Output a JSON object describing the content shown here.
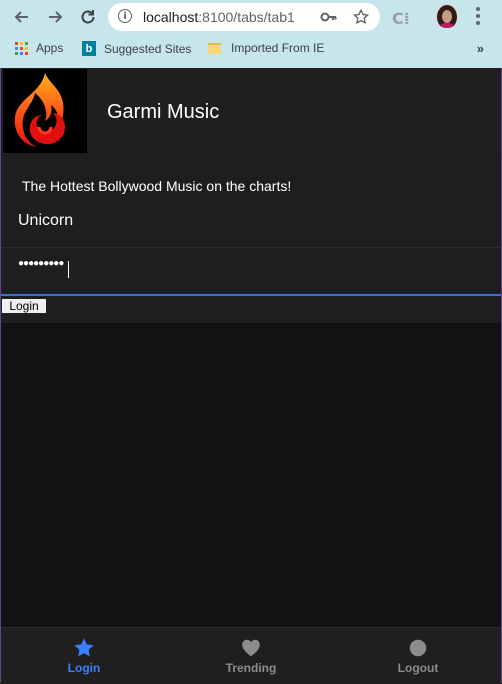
{
  "browser": {
    "url_host": "localhost",
    "url_path": ":8100/tabs/tab1"
  },
  "bookmarks": {
    "apps": "Apps",
    "suggested": "Suggested Sites",
    "imported": "Imported From IE",
    "more": "»"
  },
  "app": {
    "title": "Garmi Music",
    "subtitle": "The Hottest Bollywood Music on the charts!",
    "username": "Unicorn",
    "password_masked": "●●●●●●●●●",
    "login_button": "Login"
  },
  "tabs": [
    {
      "label": "Login",
      "icon": "star-icon",
      "active": true
    },
    {
      "label": "Trending",
      "icon": "heart-icon",
      "active": false
    },
    {
      "label": "Logout",
      "icon": "circle-icon",
      "active": false
    }
  ],
  "colors": {
    "accent": "#3880ff",
    "chrome": "#c6e6ec",
    "app_background": "#121212"
  }
}
